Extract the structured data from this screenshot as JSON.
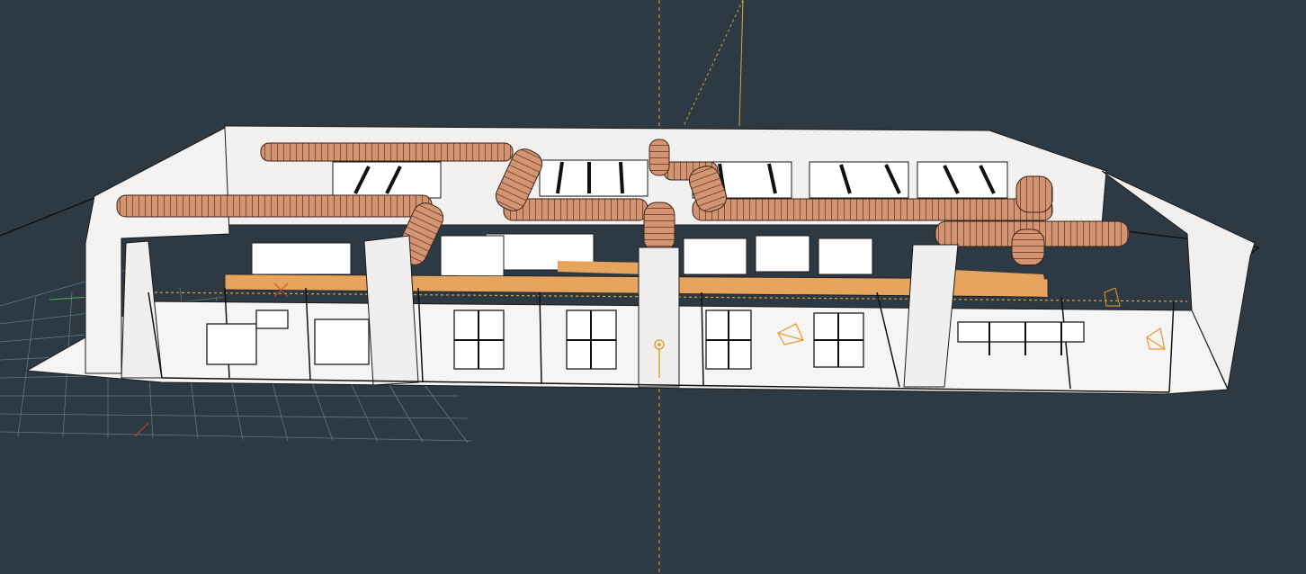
{
  "viewport": {
    "background": "#2d3943",
    "grid_color": "#5f7a84",
    "axis_color": "#d8a63a",
    "wall_color": "#f1f0ee",
    "duct_color": "#d49472",
    "duct_line_color": "#3a2418",
    "beam_color": "#e7a45e",
    "line_color": "#151515"
  },
  "scene": {
    "icons": [
      "camera-icon",
      "light-icon",
      "origin-marker-icon"
    ]
  }
}
